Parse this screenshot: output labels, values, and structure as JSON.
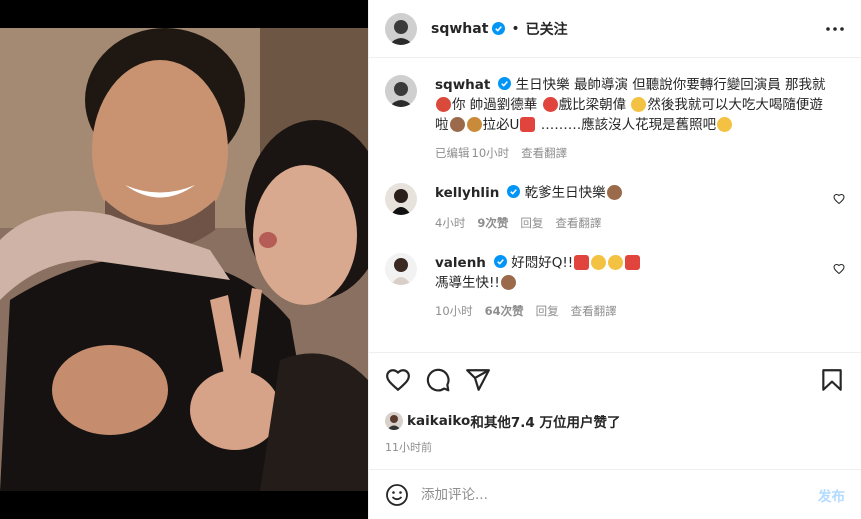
{
  "post": {
    "username": "sqwhat",
    "follow_dot": "•",
    "follow_status": "已关注",
    "caption_l1": "生日快樂 最帥導演 但聽說你要轉行變回演員 那我就",
    "caption_l2a": "你 帥過劉德華",
    "caption_l2b": "戲比梁朝偉",
    "caption_l2c": "然後我就可以大吃大喝隨便遊",
    "caption_l3a": "啦",
    "caption_l3b": "拉必U",
    "caption_l3c": "………應該沒人花現是舊照吧",
    "edited": "已编辑",
    "time": "10小时",
    "translate": "查看翻譯"
  },
  "comments": [
    {
      "username": "kellyhlin",
      "text": "乾爹生日快樂",
      "time": "4小时",
      "likes": "9次赞",
      "reply": "回复",
      "translate": "查看翻譯"
    },
    {
      "username": "valenh",
      "text_l1": "好悶好Q!!",
      "text_l2": "馮導生快!!",
      "time": "10小时",
      "likes": "64次赞",
      "reply": "回复",
      "translate": "查看翻譯"
    }
  ],
  "likes": {
    "user": "kaikaiko",
    "rest": "和其他7.4 万位用户赞了"
  },
  "post_time": "11小时前",
  "add_comment": {
    "placeholder": "添加评论...",
    "post_label": "发布"
  },
  "colors": {
    "verified": "#0095f6",
    "heart": "#ed4956",
    "post_btn": "#b3dbff"
  }
}
